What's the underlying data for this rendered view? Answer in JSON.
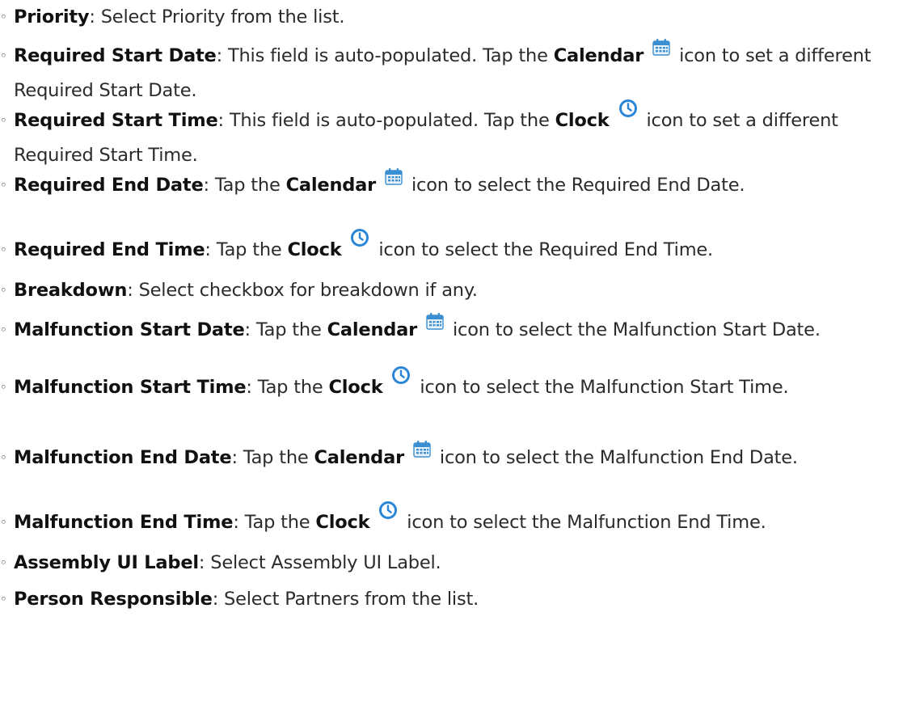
{
  "items": [
    {
      "term": "Priority",
      "parts": [
        ": Select Priority from the list."
      ]
    },
    {
      "term": "Required Start Date",
      "parts": [
        ": This field is auto-populated. Tap the ",
        {
          "b": "Calendar"
        },
        {
          "icon": "calendar-icon"
        },
        " icon to set a different Required Start Date."
      ]
    },
    {
      "term": "Required Start Time",
      "parts": [
        ": This field is auto-populated. Tap the ",
        {
          "b": "Clock"
        },
        {
          "icon": "clock-icon"
        },
        " icon to set a different Required Start Time."
      ]
    },
    {
      "term": "Required End Date",
      "parts": [
        ": Tap the ",
        {
          "b": "Calendar"
        },
        {
          "icon": "calendar-icon"
        },
        " icon to select the Required End Date."
      ]
    },
    {
      "term": "Required End Time",
      "parts": [
        ": Tap the ",
        {
          "b": "Clock"
        },
        {
          "icon": "clock-icon"
        },
        " icon to select the Required End Time."
      ]
    },
    {
      "term": "Breakdown",
      "parts": [
        ": Select checkbox for breakdown if any."
      ]
    },
    {
      "term": "Malfunction Start Date",
      "parts": [
        ": Tap the ",
        {
          "b": "Calendar"
        },
        {
          "icon": "calendar-icon"
        },
        " icon to select the Malfunction Start Date."
      ]
    },
    {
      "term": "Malfunction Start Time",
      "parts": [
        ": Tap the ",
        {
          "b": "Clock"
        },
        {
          "icon": "clock-icon"
        },
        " icon to select the Malfunction Start Time."
      ]
    },
    {
      "term": "Malfunction End Date",
      "parts": [
        ": Tap the ",
        {
          "b": "Calendar"
        },
        {
          "icon": "calendar-icon"
        },
        " icon to select the Malfunction End Date."
      ]
    },
    {
      "term": "Malfunction End Time",
      "parts": [
        ": Tap the ",
        {
          "b": "Clock"
        },
        {
          "icon": "clock-icon"
        },
        " icon to select the Malfunction End Time."
      ]
    },
    {
      "term": "Assembly UI Label",
      "parts": [
        ": Select Assembly UI Label."
      ]
    },
    {
      "term": "Person Responsible",
      "parts": [
        ": Select Partners from the list."
      ]
    }
  ],
  "bullet_glyph": "◦",
  "colors": {
    "text": "#2b2b2b",
    "calendar": "#3b8fd0",
    "clock": "#2a86d6"
  }
}
